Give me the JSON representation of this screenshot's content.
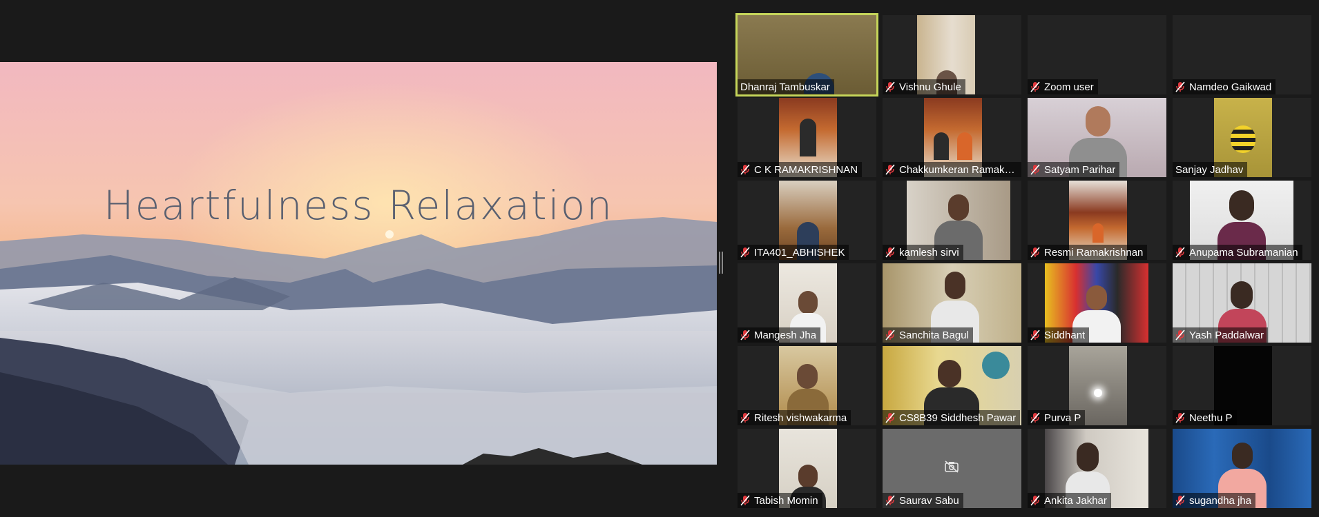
{
  "meeting": {
    "shared_slide": {
      "title": "Heartfulness  Relaxation"
    },
    "colors": {
      "background": "#1a1a1a",
      "active_speaker_border": "#c6d65a",
      "muted_icon": "#e0393e"
    },
    "participants": [
      {
        "name": "Dhanraj  Tambuskar",
        "muted": false,
        "active_speaker": true
      },
      {
        "name": "Vishnu Ghule",
        "muted": true
      },
      {
        "name": "Zoom user",
        "muted": true
      },
      {
        "name": "Namdeo Gaikwad",
        "muted": true
      },
      {
        "name": "C K RAMAKRISHNAN",
        "muted": true
      },
      {
        "name": "Chakkumkeran Ramakrishnan",
        "muted": true
      },
      {
        "name": "Satyam Parihar",
        "muted": true
      },
      {
        "name": "Sanjay Jadhav",
        "muted": false
      },
      {
        "name": "ITA401_ABHISHEK",
        "muted": true
      },
      {
        "name": "kamlesh sirvi",
        "muted": true
      },
      {
        "name": "Resmi Ramakrishnan",
        "muted": true
      },
      {
        "name": "Anupama Subramanian",
        "muted": true
      },
      {
        "name": "Mangesh Jha",
        "muted": true
      },
      {
        "name": "Sanchita Bagul",
        "muted": true
      },
      {
        "name": "Siddhant",
        "muted": true
      },
      {
        "name": "Yash Paddalwar",
        "muted": true
      },
      {
        "name": "Ritesh vishwakarma",
        "muted": true
      },
      {
        "name": "CS8B39 Siddhesh Pawar",
        "muted": true
      },
      {
        "name": "Purva P",
        "muted": true
      },
      {
        "name": "Neethu P",
        "muted": true
      },
      {
        "name": "Tabish Momin",
        "muted": true
      },
      {
        "name": "Saurav Sabu",
        "muted": true,
        "camera_off": true
      },
      {
        "name": "Ankita Jakhar",
        "muted": true
      },
      {
        "name": "sugandha jha",
        "muted": true
      }
    ]
  }
}
